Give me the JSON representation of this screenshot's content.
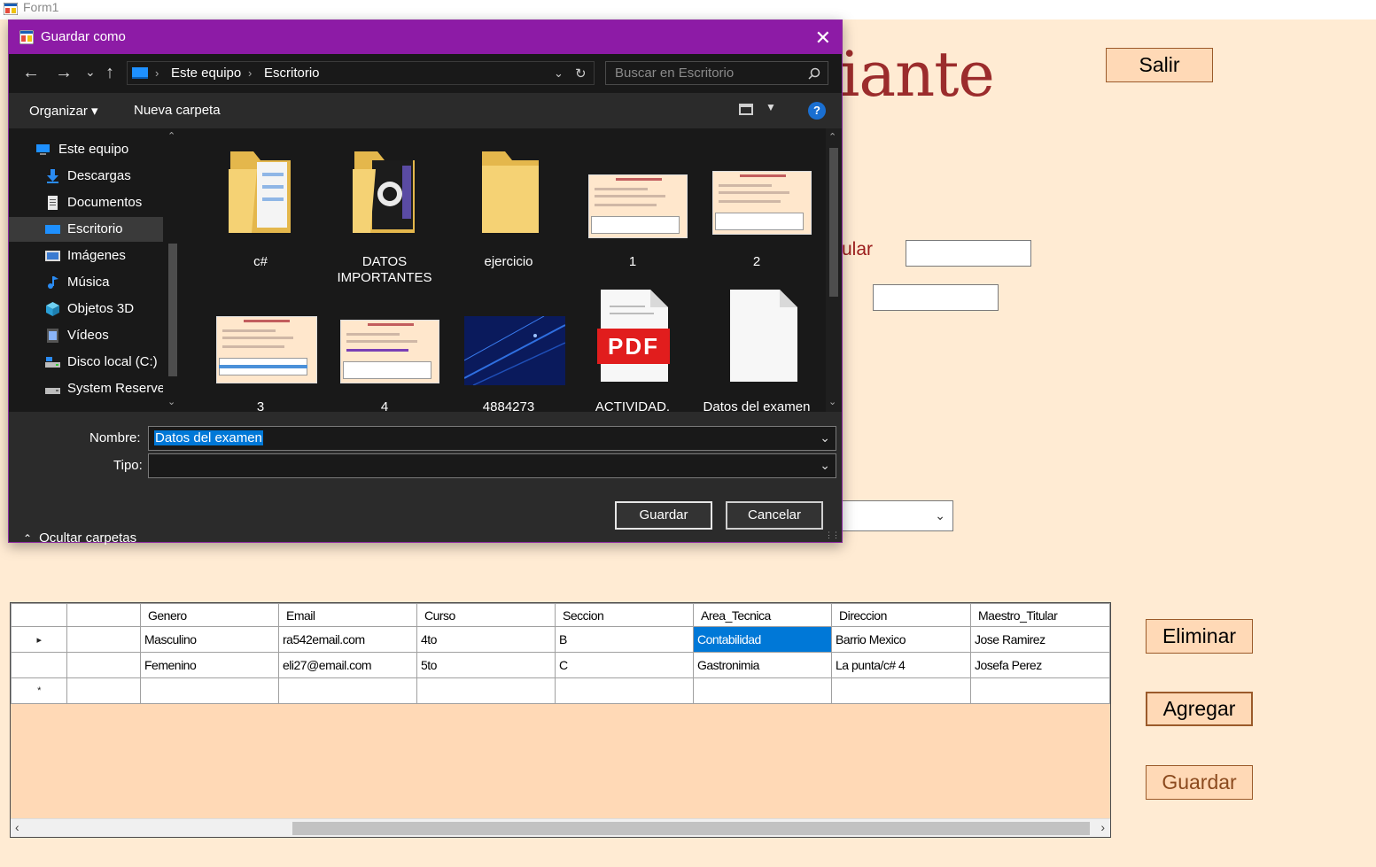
{
  "form": {
    "title": "Form1",
    "big_title_fragment": "iante",
    "label_fragment": "ular"
  },
  "buttons": {
    "salir": "Salir",
    "eliminar": "Eliminar",
    "agregar": "Agregar",
    "guardar": "Guardar"
  },
  "grid": {
    "columns": [
      "",
      "Genero",
      "Email",
      "Curso",
      "Seccion",
      "Area_Tecnica",
      "Direccion",
      "Maestro_Titular"
    ],
    "rows": [
      {
        "marker": "▸",
        "cells": [
          "",
          "Masculino",
          "ra542email.com",
          "4to",
          "B",
          "Contabilidad",
          "Barrio Mexico",
          "Jose Ramirez"
        ]
      },
      {
        "marker": "",
        "cells": [
          "",
          "Femenino",
          "eli27@email.com",
          "5to",
          "C",
          "Gastronimia",
          "La punta/c# 4",
          "Josefa Perez"
        ]
      },
      {
        "marker": "*",
        "cells": [
          "",
          "",
          "",
          "",
          "",
          "",
          "",
          ""
        ]
      }
    ],
    "selected_cell": {
      "row": 0,
      "column": "Area_Tecnica"
    }
  },
  "dialog": {
    "title": "Guardar como",
    "close_glyph": "✕",
    "nav": {
      "back": "←",
      "forward": "→",
      "recent": "⌄",
      "up": "↑",
      "refresh": "↻"
    },
    "breadcrumb": [
      "Este equipo",
      "Escritorio"
    ],
    "breadcrumb_sep": "›",
    "search_placeholder": "Buscar en Escritorio",
    "toolbar": {
      "organize": "Organizar ▾",
      "new_folder": "Nueva carpeta",
      "help": "?"
    },
    "sidebar": [
      {
        "label": "Este equipo",
        "icon": "computer-icon"
      },
      {
        "label": "Descargas",
        "icon": "download-icon"
      },
      {
        "label": "Documentos",
        "icon": "document-icon"
      },
      {
        "label": "Escritorio",
        "icon": "desktop-icon",
        "selected": true
      },
      {
        "label": "Imágenes",
        "icon": "image-icon"
      },
      {
        "label": "Música",
        "icon": "music-icon"
      },
      {
        "label": "Objetos 3D",
        "icon": "cube-icon"
      },
      {
        "label": "Vídeos",
        "icon": "video-icon"
      },
      {
        "label": "Disco local (C:)",
        "icon": "drive-icon"
      },
      {
        "label": "System Reserved",
        "icon": "drive-icon"
      }
    ],
    "files": [
      {
        "label": "c#",
        "type": "folder"
      },
      {
        "label": "DATOS IMPORTANTES",
        "type": "folder"
      },
      {
        "label": "ejercicio",
        "type": "folder"
      },
      {
        "label": "1",
        "type": "image"
      },
      {
        "label": "2",
        "type": "image"
      },
      {
        "label": "3",
        "type": "image"
      },
      {
        "label": "4",
        "type": "image"
      },
      {
        "label": "4884273",
        "type": "photo"
      },
      {
        "label": "ACTIVIDAD. Investiga TIPOS",
        "type": "pdf"
      },
      {
        "label": "Datos del examen",
        "type": "file"
      }
    ],
    "pdf_badge": "PDF",
    "name_label": "Nombre:",
    "name_value": "Datos del examen",
    "type_label": "Tipo:",
    "type_value": "",
    "save_button": "Guardar",
    "cancel_button": "Cancelar",
    "hide_folders": "Ocultar carpetas"
  },
  "colors": {
    "form_bg": "#ffebd3",
    "button_bg": "#ffd9b6",
    "title_red": "#9b2c2c",
    "dialog_accent": "#8d1ba6",
    "selection_blue": "#0078d7"
  }
}
